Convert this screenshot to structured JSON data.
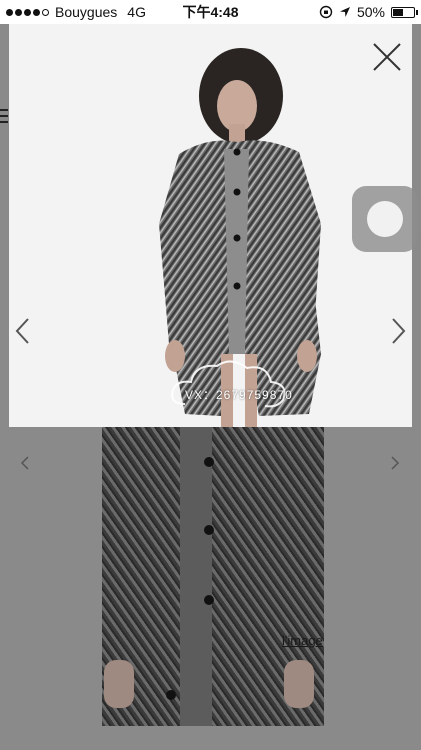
{
  "status_bar": {
    "carrier": "Bouygues",
    "network": "4G",
    "time": "下午4:48",
    "battery_percent": "50%",
    "battery_level": 0.5
  },
  "viewer": {
    "watermark": "VX：2679759870",
    "close_icon": "close-icon",
    "prev_icon": "chevron-left-icon",
    "next_icon": "chevron-right-icon"
  },
  "background_page": {
    "link_text": "l'image"
  },
  "colors": {
    "overlay_bg": "#f3f3f3",
    "dim_bg": "#8a8a8a"
  }
}
